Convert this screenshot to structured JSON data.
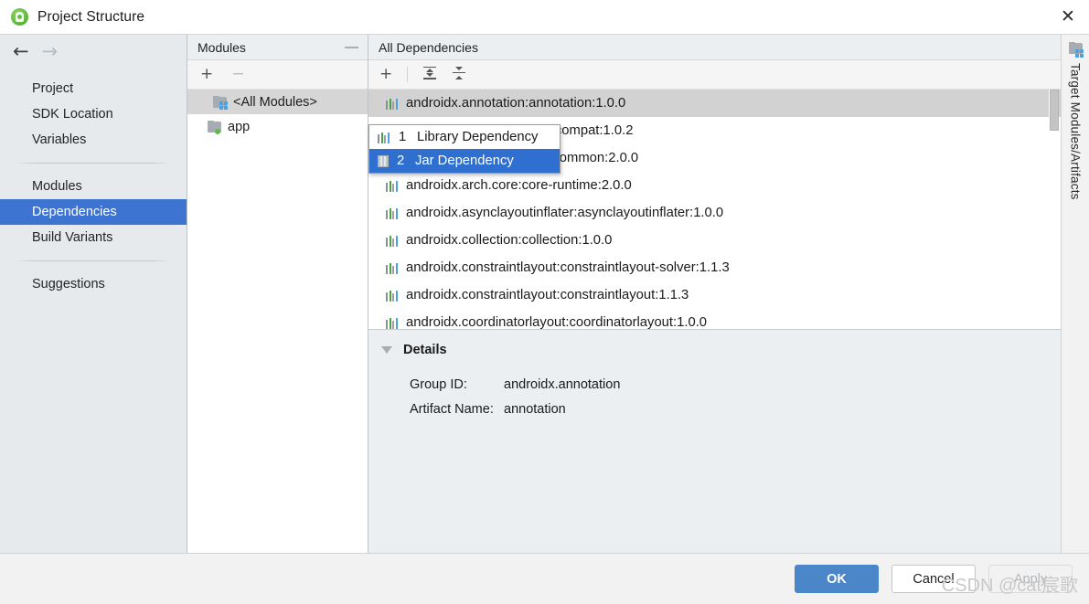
{
  "window": {
    "title": "Project Structure",
    "app_icon": "android-studio-icon",
    "close_label": "✕"
  },
  "sidebar": {
    "back_arrow": "←",
    "forward_arrow": "→",
    "group1": [
      {
        "label": "Project",
        "selected": false
      },
      {
        "label": "SDK Location",
        "selected": false
      },
      {
        "label": "Variables",
        "selected": false
      }
    ],
    "group2": [
      {
        "label": "Modules",
        "selected": false
      },
      {
        "label": "Dependencies",
        "selected": true
      },
      {
        "label": "Build Variants",
        "selected": false
      }
    ],
    "group3": [
      {
        "label": "Suggestions",
        "selected": false
      }
    ]
  },
  "modules_panel": {
    "header": "Modules",
    "minimize_label": "—",
    "toolbar": {
      "add": "+",
      "remove": "−"
    },
    "items": [
      {
        "label": "<All Modules>",
        "icon": "folder-modules-icon",
        "selected": true
      },
      {
        "label": "app",
        "icon": "folder-app-icon",
        "selected": false
      }
    ]
  },
  "main": {
    "header": "All Dependencies",
    "toolbar": {
      "add": "+",
      "expand_all": "expand-all-icon",
      "collapse_all": "collapse-all-icon"
    },
    "dependencies": [
      {
        "label": "androidx.annotation:annotation:1.0.0",
        "selected": true
      },
      {
        "label": "androidx.appcompat:appcompat:1.0.2",
        "selected": false
      },
      {
        "label": "androidx.arch.core:core-common:2.0.0",
        "selected": false
      },
      {
        "label": "androidx.arch.core:core-runtime:2.0.0",
        "selected": false
      },
      {
        "label": "androidx.asynclayoutinflater:asynclayoutinflater:1.0.0",
        "selected": false
      },
      {
        "label": "androidx.collection:collection:1.0.0",
        "selected": false
      },
      {
        "label": "androidx.constraintlayout:constraintlayout-solver:1.1.3",
        "selected": false
      },
      {
        "label": "androidx.constraintlayout:constraintlayout:1.1.3",
        "selected": false
      },
      {
        "label": "androidx.coordinatorlayout:coordinatorlayout:1.0.0",
        "selected": false
      }
    ],
    "details": {
      "title": "Details",
      "rows": [
        {
          "label": "Group ID:",
          "value": "androidx.annotation"
        },
        {
          "label": "Artifact Name:",
          "value": "annotation"
        }
      ]
    }
  },
  "popup_menu": {
    "items": [
      {
        "number": "1",
        "label": "Library Dependency",
        "icon": "library-icon",
        "highlighted": false
      },
      {
        "number": "2",
        "label": "Jar Dependency",
        "icon": "jar-icon",
        "highlighted": true
      }
    ]
  },
  "right_tab": {
    "label": "Target Modules/Artifacts",
    "icon": "folder-modules-icon"
  },
  "footer": {
    "ok": "OK",
    "cancel": "Cancel",
    "apply": "Apply"
  },
  "watermark": "CSDN @cat宸歌",
  "colors": {
    "accent_blue": "#3d74d1",
    "primary_button": "#4a86c8",
    "popup_highlight": "#2f6fd0",
    "sidebar_bg": "#e6eaed",
    "panel_header_bg": "#eceff1",
    "row_selected": "#d2d2d2"
  }
}
